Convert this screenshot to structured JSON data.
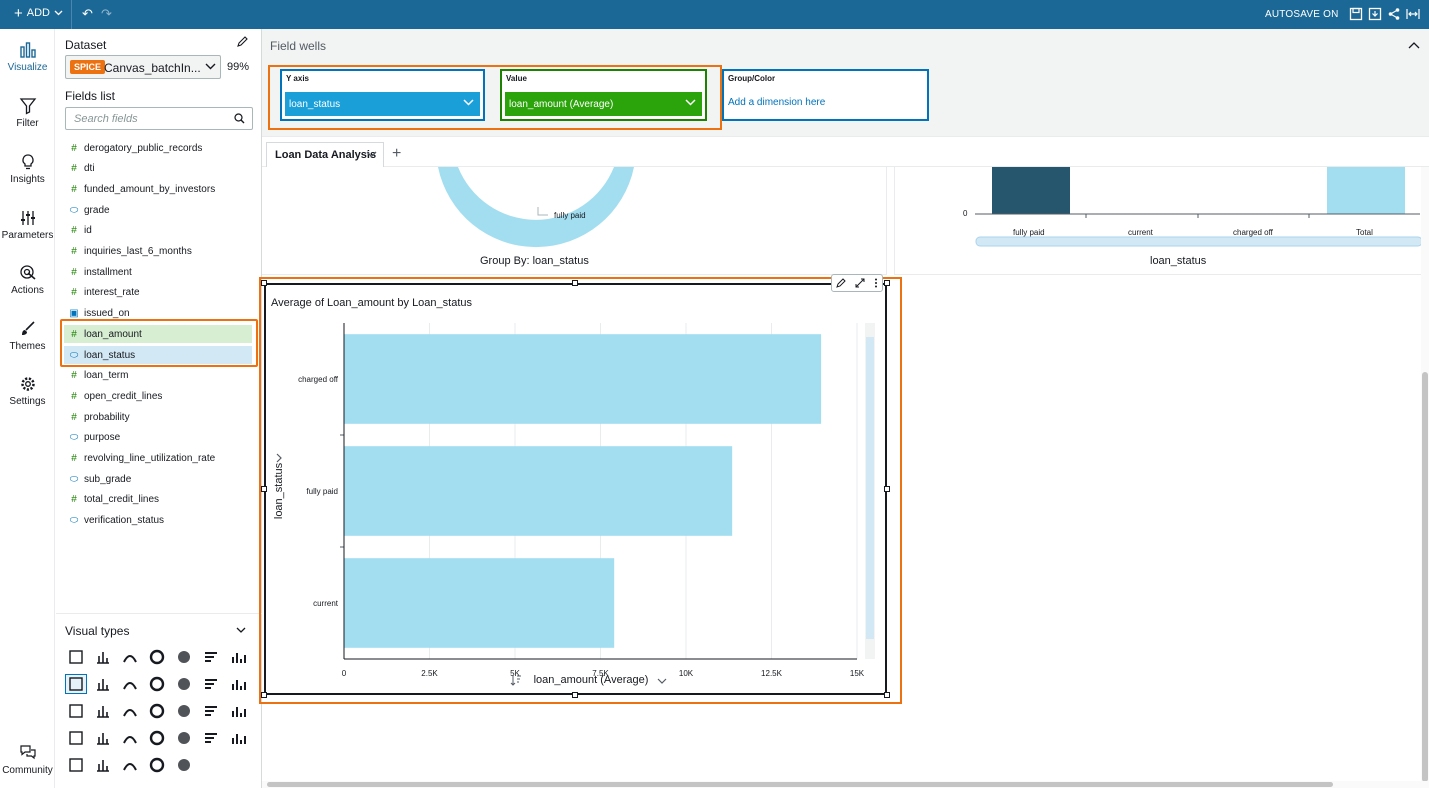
{
  "topbar": {
    "add_label": "ADD",
    "autosave_label": "AUTOSAVE ON"
  },
  "rail": [
    {
      "label": "Visualize",
      "icon": "bar-chart-icon"
    },
    {
      "label": "Filter",
      "icon": "funnel-icon"
    },
    {
      "label": "Insights",
      "icon": "lightbulb-icon"
    },
    {
      "label": "Parameters",
      "icon": "sliders-icon"
    },
    {
      "label": "Actions",
      "icon": "cursor-target-icon"
    },
    {
      "label": "Themes",
      "icon": "brush-icon"
    },
    {
      "label": "Settings",
      "icon": "gear-icon"
    },
    {
      "label": "Community",
      "icon": "chat-bubbles-icon"
    }
  ],
  "dataset": {
    "title": "Dataset",
    "badge": "SPICE",
    "name": "Canvas_batchIn...",
    "percent": "99%"
  },
  "fields": {
    "title": "Fields list",
    "search_placeholder": "Search fields",
    "items": [
      {
        "name": "derogatory_public_records",
        "type": "#"
      },
      {
        "name": "dti",
        "type": "#"
      },
      {
        "name": "funded_amount_by_investors",
        "type": "#"
      },
      {
        "name": "grade",
        "type": "dim"
      },
      {
        "name": "id",
        "type": "#"
      },
      {
        "name": "inquiries_last_6_months",
        "type": "#"
      },
      {
        "name": "installment",
        "type": "#"
      },
      {
        "name": "interest_rate",
        "type": "#"
      },
      {
        "name": "issued_on",
        "type": "date"
      },
      {
        "name": "loan_amount",
        "type": "#"
      },
      {
        "name": "loan_status",
        "type": "dim"
      },
      {
        "name": "loan_term",
        "type": "#"
      },
      {
        "name": "open_credit_lines",
        "type": "#"
      },
      {
        "name": "probability",
        "type": "#"
      },
      {
        "name": "purpose",
        "type": "dim"
      },
      {
        "name": "revolving_line_utilization_rate",
        "type": "#"
      },
      {
        "name": "sub_grade",
        "type": "dim"
      },
      {
        "name": "total_credit_lines",
        "type": "#"
      },
      {
        "name": "verification_status",
        "type": "dim"
      }
    ]
  },
  "visual_types": {
    "title": "Visual types"
  },
  "field_wells": {
    "title": "Field wells",
    "y_axis": {
      "label": "Y axis",
      "value": "loan_status"
    },
    "value": {
      "label": "Value",
      "value": "loan_amount (Average)"
    },
    "group": {
      "label": "Group/Color",
      "placeholder": "Add a dimension here"
    }
  },
  "sheet": {
    "tab_name": "Loan Data Analysis"
  },
  "top_left_visual": {
    "slice_label": "fully paid",
    "caption": "Group By: loan_status"
  },
  "top_right_visual": {
    "zero_label": "0",
    "categories": [
      "fully paid",
      "current",
      "charged off",
      "Total"
    ],
    "xlabel": "loan_status"
  },
  "colors": {
    "accent_orange": "#ec7211",
    "bar_light": "#a2def0",
    "bar_dark": "#26566e",
    "well_blue": "#1a9fd9",
    "well_green": "#2ba30b"
  },
  "chart_data": {
    "type": "bar",
    "orientation": "horizontal",
    "title": "Average of Loan_amount by Loan_status",
    "ylabel": "loan_status",
    "xlabel": "loan_amount (Average)",
    "categories": [
      "charged off",
      "fully paid",
      "current"
    ],
    "values": [
      13950,
      11350,
      7900
    ],
    "xlim": [
      0,
      15000
    ],
    "xticks": [
      "0",
      "2.5K",
      "5K",
      "7.5K",
      "10K",
      "12.5K",
      "15K"
    ],
    "grid": "vertical"
  }
}
